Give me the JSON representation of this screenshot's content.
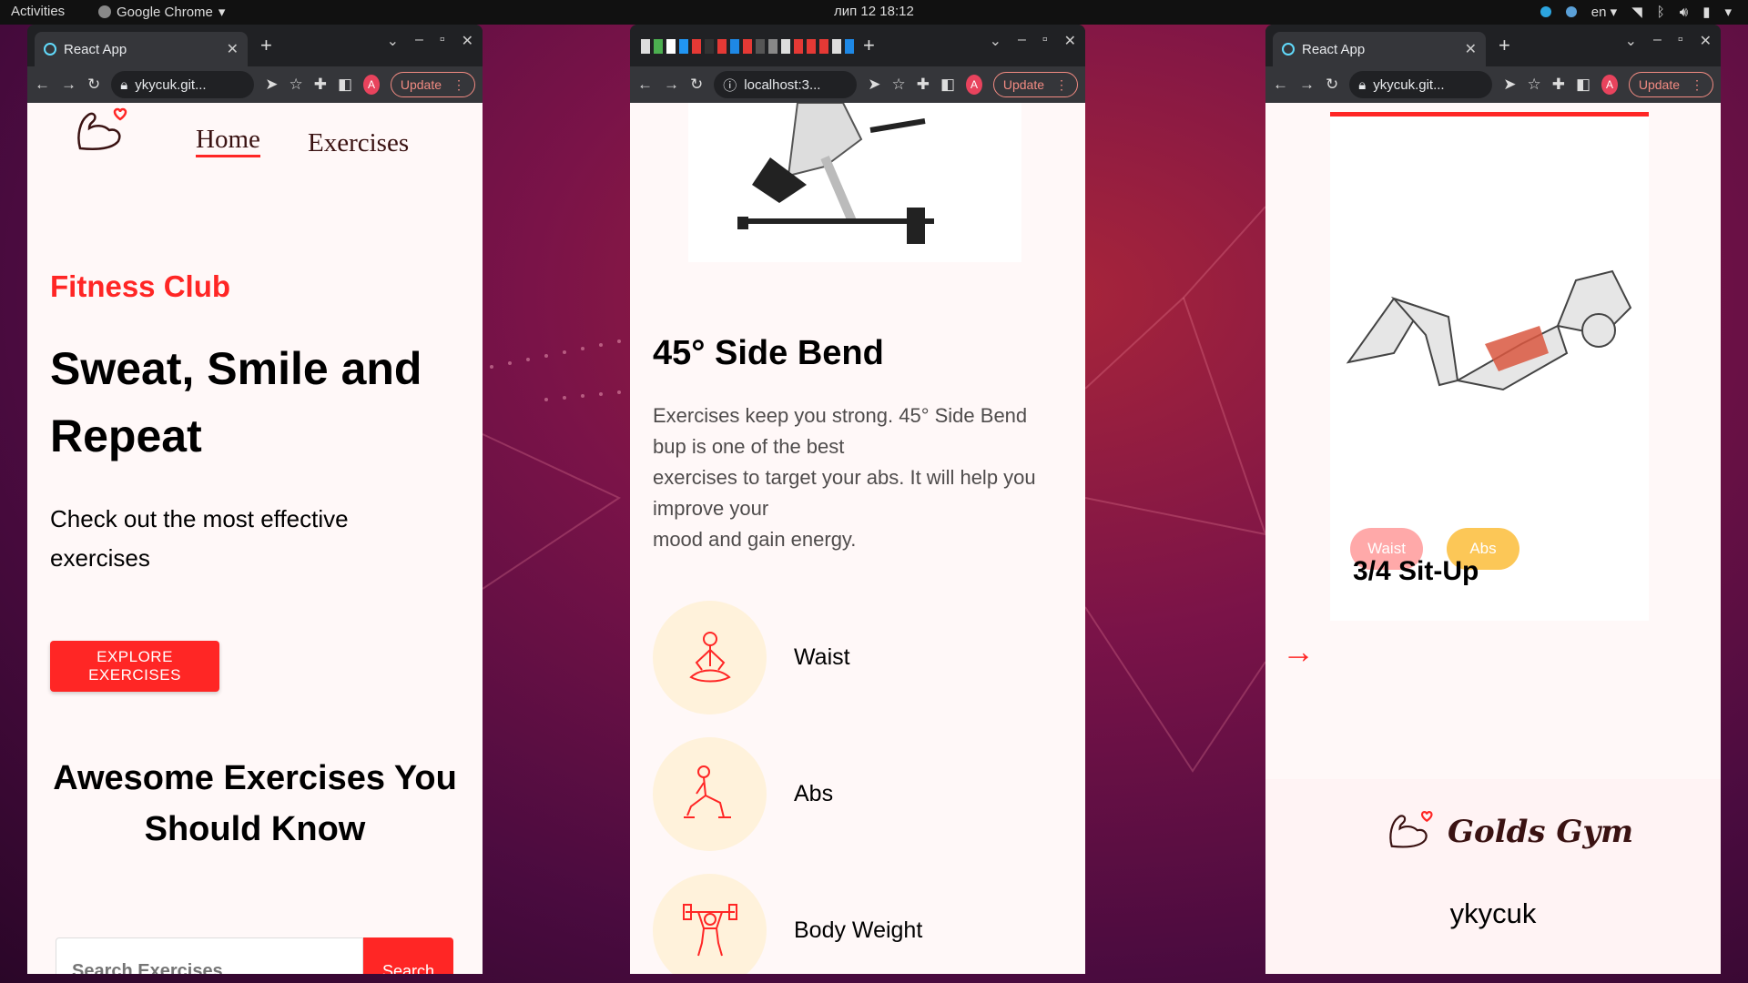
{
  "topbar": {
    "activities": "Activities",
    "app_name": "Google Chrome",
    "clock": "лип 12  18:12",
    "lang": "en"
  },
  "window1": {
    "tab_title": "React App",
    "url": "ykycuk.git...",
    "update_label": "Update",
    "nav": {
      "home": "Home",
      "exercises": "Exercises"
    },
    "hero": {
      "club": "Fitness Club",
      "headline": "Sweat, Smile and Repeat",
      "subtitle": "Check out the most effective exercises",
      "cta": "EXPLORE EXERCISES"
    },
    "section_title": "Awesome Exercises You Should Know",
    "search": {
      "placeholder": "Search Exercises",
      "button": "Search"
    }
  },
  "window2": {
    "url": "localhost:3...",
    "update_label": "Update",
    "exercise_title": "45° Side Bend",
    "description_lines": [
      "Exercises keep you strong. 45° Side Bend",
      "bup is one of the best",
      "exercises to target your abs. It will help you",
      "improve your",
      "mood and gain energy."
    ],
    "details": [
      {
        "icon": "meditation-icon",
        "label": "Waist"
      },
      {
        "icon": "lunge-icon",
        "label": "Abs"
      },
      {
        "icon": "weightlifter-icon",
        "label": "Body Weight"
      }
    ]
  },
  "window3": {
    "tab_title": "React App",
    "url": "ykycuk.git...",
    "update_label": "Update",
    "card": {
      "tag1": "Waist",
      "tag2": "Abs",
      "title": "3/4 Sit-Up"
    },
    "footer": {
      "brand": "Golds Gym",
      "author": "ykycuk"
    }
  },
  "colors": {
    "accent": "#FF2625",
    "tag_waist": "#FFA9A9",
    "tag_abs": "#FCC757",
    "circle_bg": "#FFF2DB"
  }
}
